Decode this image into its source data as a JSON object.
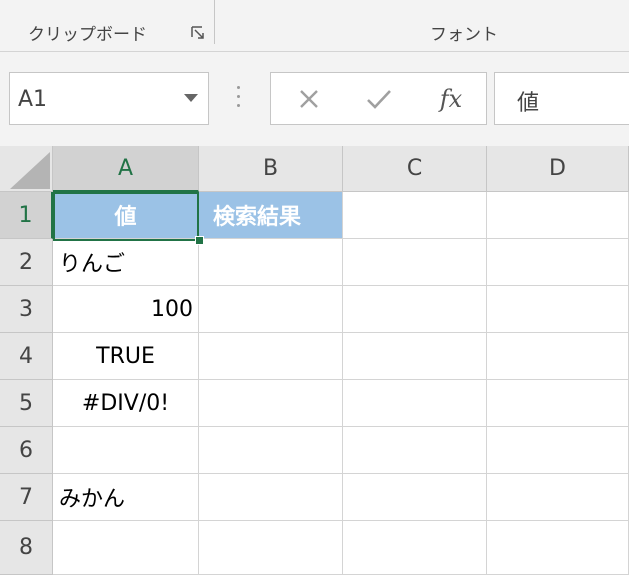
{
  "ribbon": {
    "groups": [
      {
        "label": "クリップボード"
      },
      {
        "label": "フォント"
      }
    ]
  },
  "formula_bar": {
    "name_box": "A1",
    "cancel_icon": "cross-icon",
    "enter_icon": "check-icon",
    "fx_label": "fx",
    "content": "値"
  },
  "grid": {
    "columns": [
      "A",
      "B",
      "C",
      "D"
    ],
    "selected_column": "A",
    "rows": [
      "1",
      "2",
      "3",
      "4",
      "5",
      "6",
      "7",
      "8"
    ],
    "selected_row": "1",
    "cells": {
      "A1": "値",
      "B1": "検索結果",
      "A2": "りんご",
      "A3": "100",
      "A4": "TRUE",
      "A5": "#DIV/0!",
      "A7": "みかん"
    },
    "header_fill": "#9bc2e6",
    "selection_color": "#217346"
  }
}
